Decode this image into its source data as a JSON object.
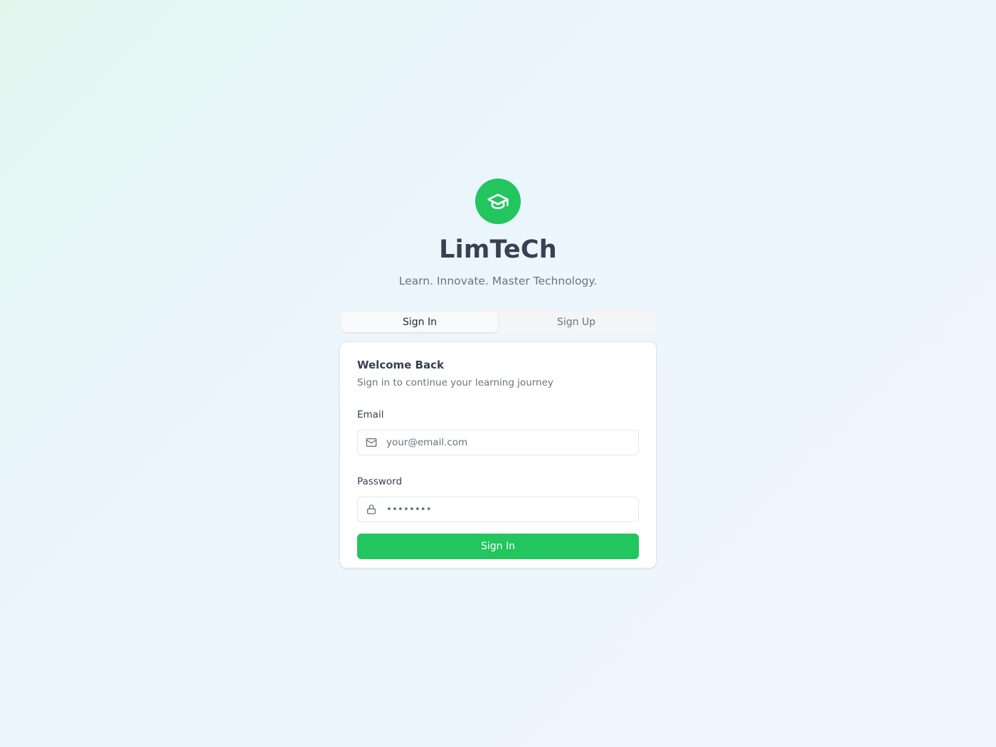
{
  "brand": {
    "title": "LimTeCh",
    "tagline": "Learn. Innovate. Master Technology.",
    "logo_icon": "graduation-cap-icon",
    "accent_color": "#22c55e"
  },
  "tabs": [
    {
      "label": "Sign In",
      "active": true
    },
    {
      "label": "Sign Up",
      "active": false
    }
  ],
  "card": {
    "title": "Welcome Back",
    "subtitle": "Sign in to continue your learning journey"
  },
  "form": {
    "email": {
      "label": "Email",
      "placeholder": "your@email.com",
      "value": "",
      "icon": "mail-icon"
    },
    "password": {
      "label": "Password",
      "placeholder": "••••••••",
      "value": "",
      "icon": "lock-icon"
    },
    "submit_label": "Sign In"
  }
}
